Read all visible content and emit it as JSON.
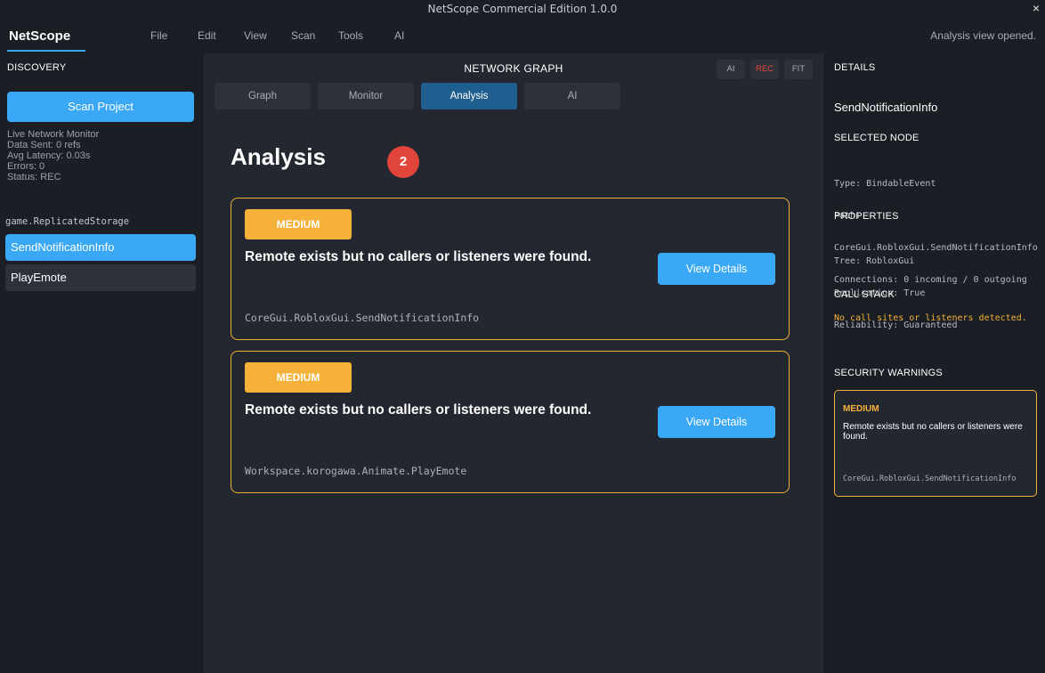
{
  "window": {
    "title": "NetScope Commercial Edition 1.0.0",
    "close_label": "×"
  },
  "menubar": {
    "brand": "NetScope",
    "menus": [
      "File",
      "Edit",
      "View",
      "Scan",
      "Tools",
      "AI"
    ],
    "status": "Analysis view opened."
  },
  "discovery": {
    "title": "DISCOVERY",
    "scan_button": "Scan Project",
    "monitor": {
      "title": "Live Network Monitor",
      "data_sent": "Data Sent: 0 refs",
      "avg_latency": "Avg Latency: 0.03s",
      "errors": "Errors: 0",
      "status": "Status: REC"
    },
    "storage_label": "game.ReplicatedStorage",
    "nodes": [
      "SendNotificationInfo",
      "PlayEmote"
    ]
  },
  "center": {
    "title": "NETWORK GRAPH",
    "toolbar": [
      "AI",
      "REC",
      "FIT"
    ],
    "tabs": [
      "Graph",
      "Monitor",
      "Analysis",
      "AI"
    ],
    "active_tab": "Analysis",
    "page_title": "Analysis",
    "issue_count": "2",
    "findings": [
      {
        "severity": "MEDIUM",
        "message": "Remote exists but no callers or listeners were found.",
        "button": "View Details",
        "path": "CoreGui.RobloxGui.SendNotificationInfo"
      },
      {
        "severity": "MEDIUM",
        "message": "Remote exists but no callers or listeners were found.",
        "button": "View Details",
        "path": "Workspace.korogawa.Animate.PlayEmote"
      }
    ]
  },
  "details": {
    "title": "DETAILS",
    "node_name": "SendNotificationInfo",
    "selected_node": {
      "title": "SELECTED NODE",
      "type": "Type: BindableEvent",
      "path_label": "Path:",
      "path": "CoreGui.RobloxGui.SendNotificationInfo",
      "connections": "Connections: 0 incoming / 0 outgoing"
    },
    "properties": {
      "title": "PROPERTIES",
      "tree": "Tree: RobloxGui",
      "replication": "Replication: True",
      "reliability": "Reliability: Guaranteed"
    },
    "call_stack": {
      "title": "CALL STACK",
      "message": "No call sites or listeners detected."
    },
    "security": {
      "title": "SECURITY WARNINGS",
      "severity": "MEDIUM",
      "message": "Remote exists but no callers or listeners were found.",
      "path": "CoreGui.RobloxGui.SendNotificationInfo"
    }
  },
  "colors": {
    "accent": "#3aa8f5",
    "active_tab": "#1e5f8f",
    "warning": "#f6b13b",
    "danger": "#e0443a"
  }
}
